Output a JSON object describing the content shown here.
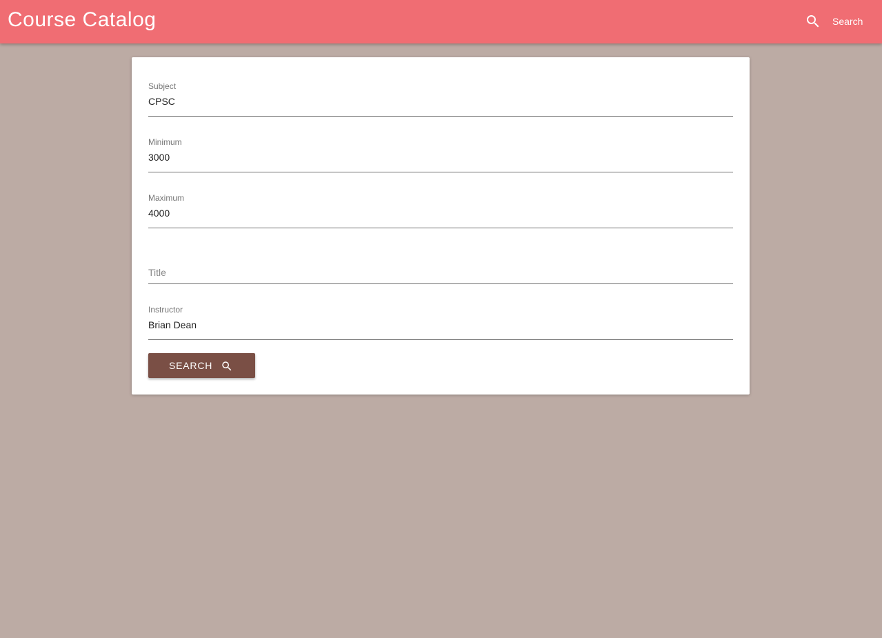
{
  "app": {
    "title": "Course Catalog",
    "search_label": "Search",
    "search_icon": "search-icon"
  },
  "colors": {
    "appbar": "#f06d73",
    "background": "#bcaba4",
    "card": "#ffffff",
    "button": "#7a4f45"
  },
  "form": {
    "subject": {
      "label": "Subject",
      "value": "CPSC"
    },
    "minimum": {
      "label": "Minimum",
      "value": "3000"
    },
    "maximum": {
      "label": "Maximum",
      "value": "4000"
    },
    "title": {
      "placeholder": "Title",
      "value": ""
    },
    "instructor": {
      "label": "Instructor",
      "value": "Brian Dean"
    },
    "search_button": {
      "label": "SEARCH",
      "icon": "search-icon"
    }
  }
}
